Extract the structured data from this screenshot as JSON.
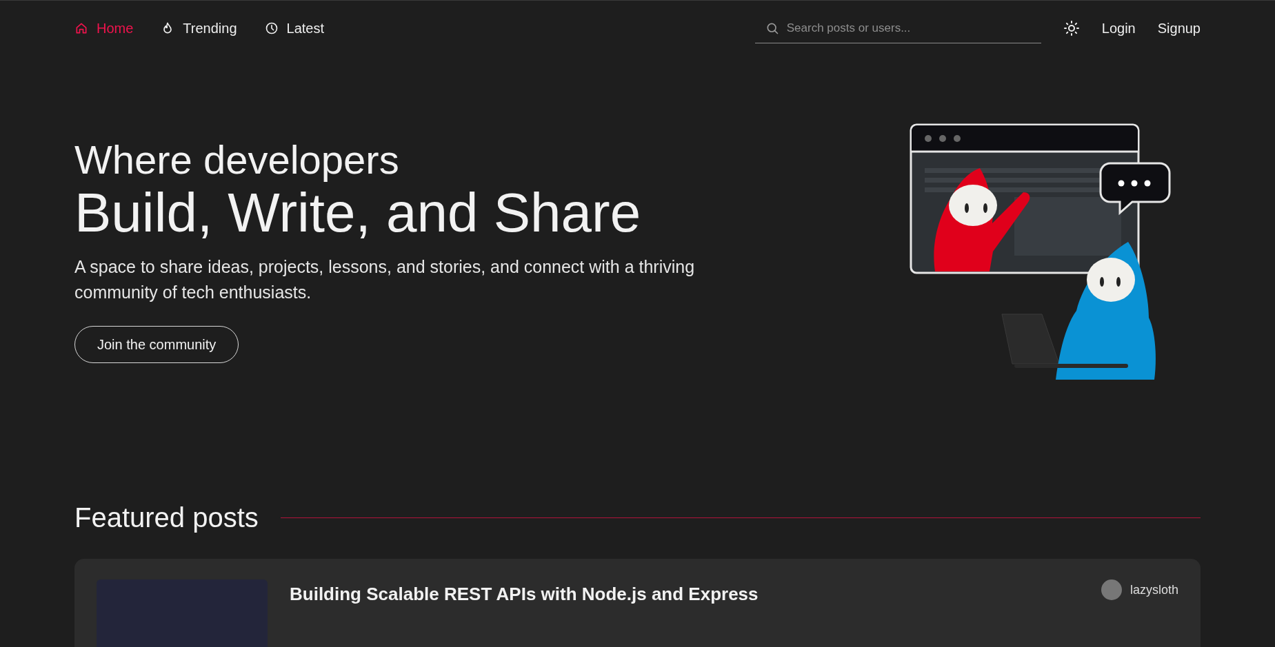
{
  "nav": {
    "items": [
      {
        "label": "Home",
        "selected": true
      },
      {
        "label": "Trending",
        "selected": false
      },
      {
        "label": "Latest",
        "selected": false
      }
    ],
    "search": {
      "placeholder": "Search posts or users..."
    },
    "actions": [
      "Login",
      "Signup"
    ]
  },
  "hero": {
    "kicker": "Where developers",
    "headline": "Build, Write, and Share",
    "description": "A space to share ideas, projects, lessons, and stories, and connect with a thriving community of tech enthusiasts.",
    "button": "Join the community"
  },
  "featured": {
    "title": "Featured posts",
    "posts": [
      {
        "title": "Building Scalable REST APIs with Node.js and Express",
        "author": "lazysloth"
      }
    ]
  }
}
